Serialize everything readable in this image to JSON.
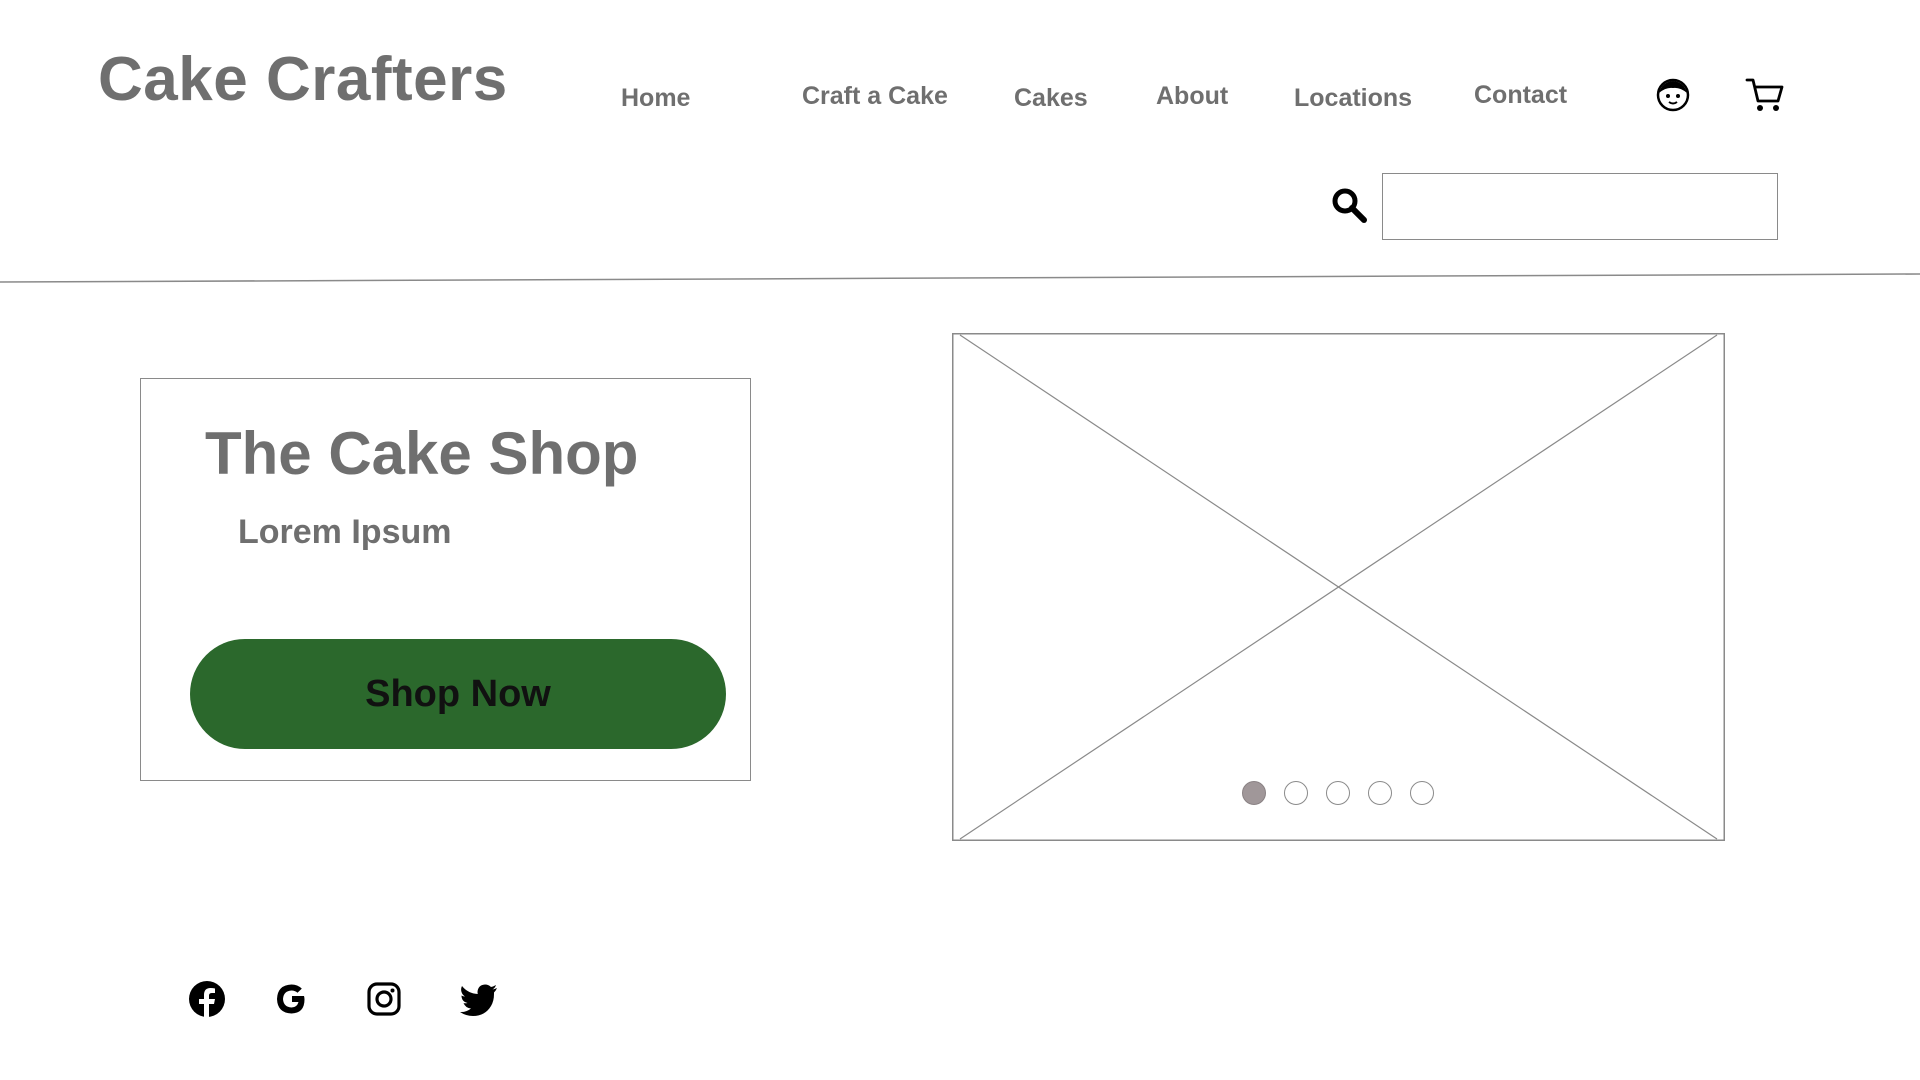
{
  "header": {
    "logo": "Cake Crafters",
    "nav": [
      {
        "label": "Home"
      },
      {
        "label": "Craft a Cake"
      },
      {
        "label": "Cakes"
      },
      {
        "label": "About"
      },
      {
        "label": "Locations"
      },
      {
        "label": "Contact"
      }
    ],
    "icons": {
      "account": "user-face-icon",
      "cart": "cart-icon"
    },
    "search": {
      "icon": "search-icon",
      "value": "",
      "placeholder": ""
    }
  },
  "hero": {
    "title": "The Cake Shop",
    "subtitle": "Lorem Ipsum",
    "button_label": "Shop Now",
    "button_color": "#2b682c"
  },
  "carousel": {
    "image": "image-placeholder",
    "slide_count": 5,
    "active_slide": 1
  },
  "footer": {
    "social": [
      "facebook-icon",
      "google-icon",
      "instagram-icon",
      "twitter-icon"
    ]
  }
}
